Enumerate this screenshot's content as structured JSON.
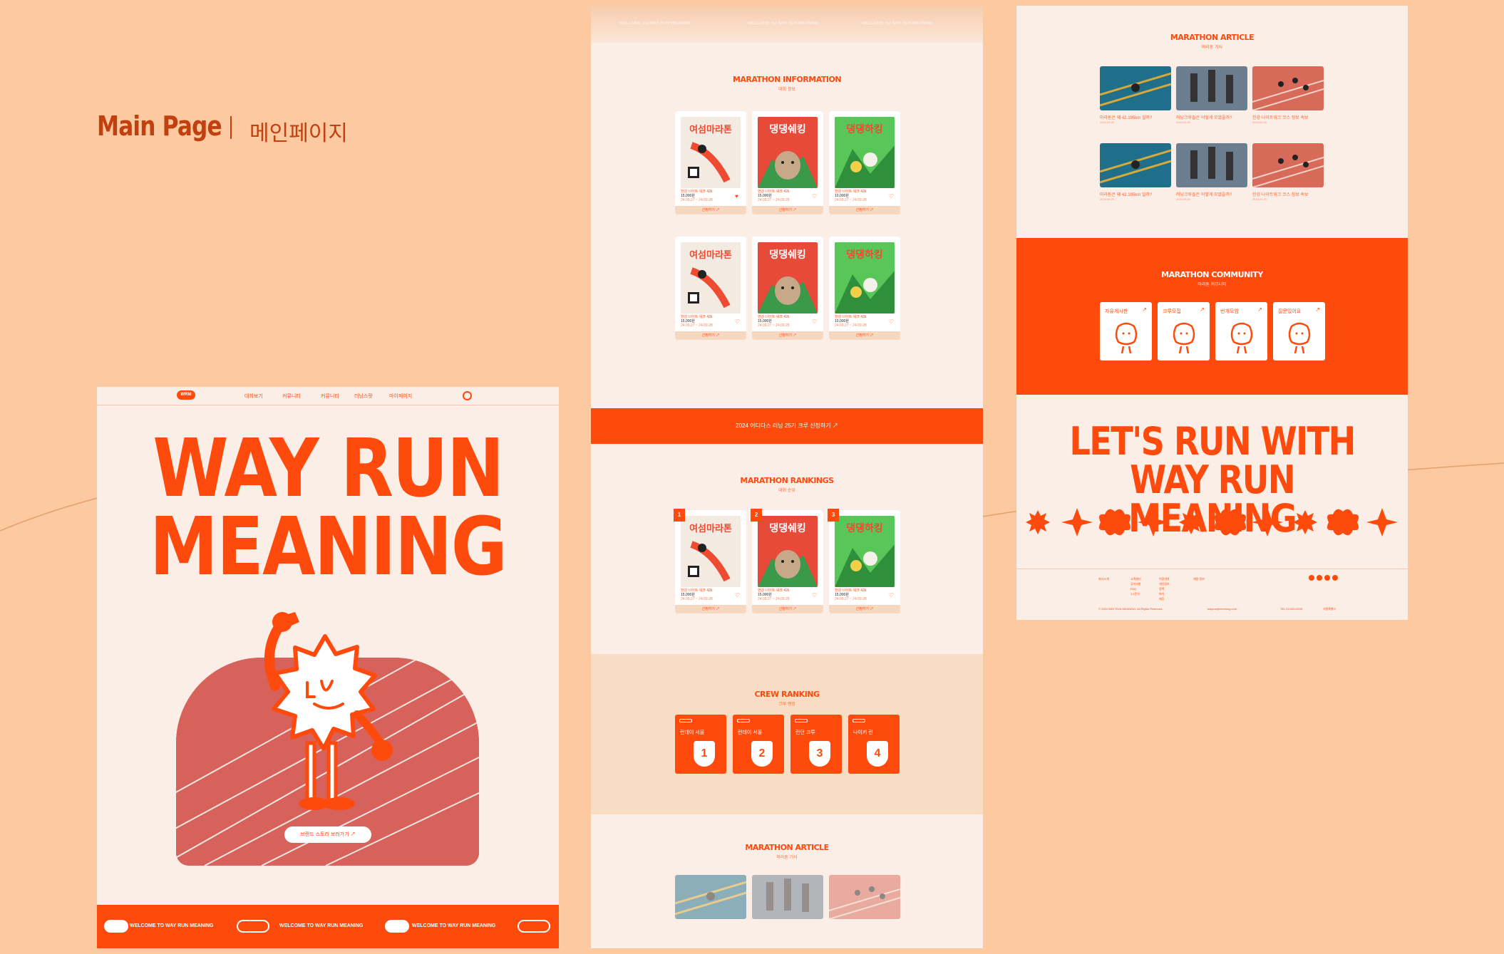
{
  "page": {
    "title": "Main Page",
    "title_kr": "메인페이지"
  },
  "left": {
    "logo": "WRM",
    "nav": [
      "대회보기",
      "커뮤니티",
      "커뮤니티",
      "러닝스팟",
      "마이페이지"
    ],
    "hero_title_1": "WAY RUN",
    "hero_title_2": "MEANING",
    "hero_button": "브랜드 스토리 보러가기 ↗",
    "ticker": "WELCOME TO WAY RUN MEANING"
  },
  "middle": {
    "ticker": "WELCOME TO WAY RUN MEANING",
    "info_title": "MARATHON INFORMATION",
    "info_sub": "대회 정보",
    "cards": [
      {
        "name": "한강 나이트 워크 42k",
        "price": "15,000원",
        "date": "24.09.27 ~ 24.09.28",
        "btn": "신청하기 ↗",
        "poster": "yeosu"
      },
      {
        "name": "한강 나이트 워크 42k",
        "price": "15,000원",
        "date": "24.09.27 ~ 24.09.28",
        "btn": "신청하기 ↗",
        "poster": "dog"
      },
      {
        "name": "한강 나이트 워크 42k",
        "price": "10,000원",
        "date": "24.09.27 ~ 24.09.28",
        "btn": "신청하기 ↗",
        "poster": "hiking"
      },
      {
        "name": "한강 나이트 워크 42k",
        "price": "15,000원",
        "date": "24.09.27 ~ 24.09.28",
        "btn": "신청하기 ↗",
        "poster": "yeosu"
      },
      {
        "name": "한강 나이트 워크 42k",
        "price": "15,000원",
        "date": "24.09.27 ~ 24.09.28",
        "btn": "신청하기 ↗",
        "poster": "dog"
      },
      {
        "name": "한강 나이트 워크 42k",
        "price": "10,000원",
        "date": "24.09.27 ~ 24.09.28",
        "btn": "신청하기 ↗",
        "poster": "hiking"
      }
    ],
    "banner": "2024 어디다스 러닝 25기 크루 신청하기 ↗",
    "rank_title": "MARATHON RANKINGS",
    "rank_sub": "대회 순위",
    "rank_cards": [
      {
        "rank": "1",
        "name": "한강 나이트 워크 42k",
        "price": "15,000원",
        "date": "24.09.27 ~ 24.09.28",
        "btn": "신청하기 ↗"
      },
      {
        "rank": "2",
        "name": "한강 나이트 워크 42k",
        "price": "15,000원",
        "date": "24.09.27 ~ 24.09.28",
        "btn": "신청하기 ↗"
      },
      {
        "rank": "3",
        "name": "한강 나이트 워크 42k",
        "price": "15,000원",
        "date": "24.09.27 ~ 24.09.28",
        "btn": "신청하기 ↗"
      }
    ],
    "crew_title": "CREW RANKING",
    "crew_sub": "크루 랭킹",
    "crews": [
      {
        "name": "런데이 서울",
        "rank": "1"
      },
      {
        "name": "런데이 서울",
        "rank": "2"
      },
      {
        "name": "런던 크루",
        "rank": "3"
      },
      {
        "name": "나이키 런",
        "rank": "4"
      }
    ],
    "article_title": "MARATHON ARTICLE",
    "article_sub": "마라톤 기사"
  },
  "right": {
    "article_title": "MARATHON ARTICLE",
    "article_sub": "마라톤 기사",
    "articles": [
      {
        "title": "마라톤은 왜 42.195km 일까?",
        "date": "2024.09.20"
      },
      {
        "title": "러닝크루들은 어떻게 모였을까?",
        "date": "2024.09.20"
      },
      {
        "title": "한강 나이트워크 코스 정보 속보",
        "date": "2024.09.20"
      },
      {
        "title": "마라톤은 왜 42.195km 일까?",
        "date": "2024.09.20"
      },
      {
        "title": "러닝크루들은 어떻게 모였을까?",
        "date": "2024.09.20"
      },
      {
        "title": "한강 나이트워크 코스 정보 속보",
        "date": "2024.09.20"
      }
    ],
    "community_title": "MARATHON COMMUNITY",
    "community_sub": "마라톤 커뮤니티",
    "community": [
      "자유게시판",
      "크루모집",
      "번개모임",
      "질문있어요"
    ],
    "closing_1": "LET'S RUN WITH",
    "closing_2": "WAY RUN MEANING",
    "footer": {
      "c1": "회사소개",
      "c2": [
        "고객센터",
        "공지사항",
        "FAQ",
        "1:1문의"
      ],
      "c3": [
        "이용약관",
        "개인정보",
        "정책",
        "위치",
        "제휴"
      ],
      "c4": "채용 정보",
      "copyright": "© 2024 WAY RUN MEANING. All Rights Reserved.",
      "email": "wayrun@meaning.com",
      "tel": "TEL 02-000-0000",
      "addr": "서울특별시"
    }
  },
  "colors": {
    "accent": "#ff4a0d",
    "bg": "#fdc9a0",
    "panel": "#fbeee6"
  }
}
